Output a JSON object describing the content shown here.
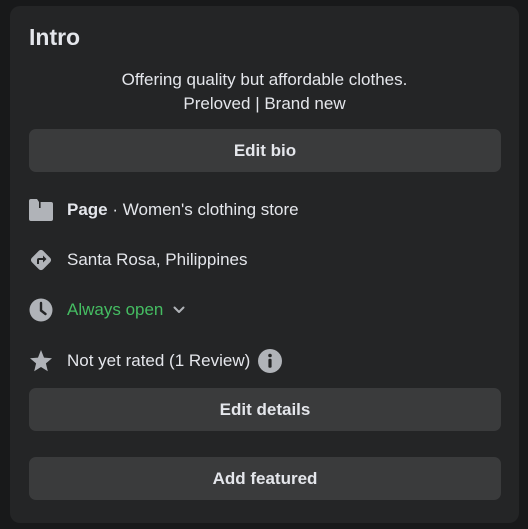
{
  "intro": {
    "title": "Intro",
    "bio_line1": "Offering quality but affordable clothes.",
    "bio_line2": "Preloved | Brand new",
    "edit_bio_label": "Edit bio",
    "page_label": "Page",
    "category": " · Women's clothing store",
    "location": "Santa Rosa, Philippines",
    "hours": "Always open",
    "rating": "Not yet rated (1 Review)",
    "edit_details_label": "Edit details",
    "add_featured_label": "Add featured"
  },
  "colors": {
    "card_bg": "#242526",
    "button_bg": "#3a3b3c",
    "text": "#e4e6eb",
    "icon": "#b0b3b8",
    "open_green": "#45bd62"
  },
  "icons": [
    "page-icon",
    "directions-icon",
    "clock-icon",
    "chevron-down-icon",
    "star-icon",
    "info-icon"
  ]
}
